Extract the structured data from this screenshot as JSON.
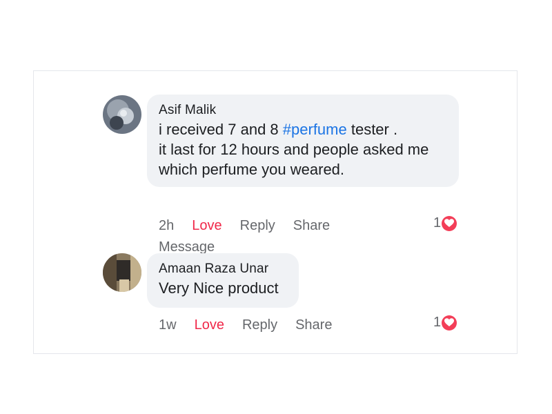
{
  "comments": [
    {
      "author": "Asif Malik",
      "text_before": "i received 7 and 8 ",
      "hashtag": "#perfume",
      "text_after": " tester .\nit last for 12 hours and people asked me\nwhich perfume you weared.",
      "time": "2h",
      "love": "Love",
      "reply": "Reply",
      "share": "Share",
      "message": "Message",
      "reaction_count": "1",
      "reaction_icon": "heart-reaction-icon"
    },
    {
      "author": "Amaan Raza Unar",
      "text": "Very Nice product",
      "time": "1w",
      "love": "Love",
      "reply": "Reply",
      "share": "Share",
      "reaction_count": "1",
      "reaction_icon": "heart-reaction-icon"
    }
  ],
  "colors": {
    "love": "#f02849",
    "hashtag": "#1b74e4",
    "bubble": "#f0f2f5",
    "heart": "#f33e58"
  }
}
